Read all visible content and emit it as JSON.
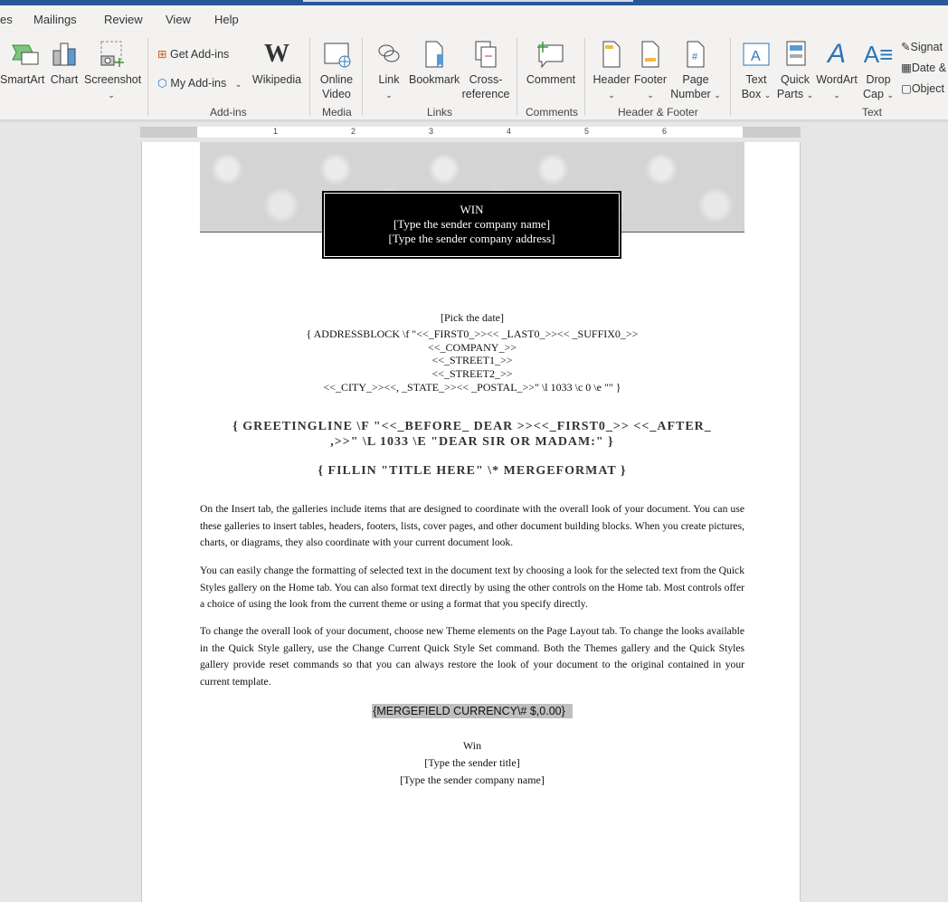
{
  "tabs": [
    "es",
    "Mailings",
    "Review",
    "View",
    "Help"
  ],
  "ribbon": {
    "illustrations": {
      "smartart": "SmartArt",
      "chart": "Chart",
      "screenshot": "Screenshot"
    },
    "addins": {
      "get": "Get Add-ins",
      "my": "My Add-ins",
      "wikipedia": "Wikipedia",
      "group": "Add-ins"
    },
    "media": {
      "online_video_1": "Online",
      "online_video_2": "Video",
      "group": "Media"
    },
    "links": {
      "link": "Link",
      "bookmark": "Bookmark",
      "cross1": "Cross-",
      "cross2": "reference",
      "group": "Links"
    },
    "comments": {
      "comment": "Comment",
      "group": "Comments"
    },
    "header_footer": {
      "header": "Header",
      "footer": "Footer",
      "page1": "Page",
      "page2": "Number",
      "group": "Header & Footer"
    },
    "text": {
      "textbox1": "Text",
      "textbox2": "Box",
      "quick1": "Quick",
      "quick2": "Parts",
      "wordart": "WordArt",
      "drop1": "Drop",
      "drop2": "Cap",
      "signature": "Signat",
      "date": "Date &",
      "object": "Object",
      "group": "Text"
    }
  },
  "ruler": [
    "1",
    "2",
    "3",
    "4",
    "5",
    "6"
  ],
  "doc": {
    "header_box": [
      "WIN",
      "[Type the sender company name]",
      "[Type the sender company address]"
    ],
    "date": "[Pick the date]",
    "address": [
      "{ ADDRESSBLOCK \\f \"<<_FIRST0_>><< _LAST0_>><< _SUFFIX0_>>",
      "<<_COMPANY_>>",
      "<<_STREET1_>>",
      "<<_STREET2_>>",
      "<<_CITY_>><<, _STATE_>><< _POSTAL_>>\" \\l 1033 \\c 0 \\e \"\" }"
    ],
    "greeting": [
      "{ GREETINGLINE \\F \"<<_BEFORE_ DEAR >><<_FIRST0_>> <<_AFTER_",
      ",>>\" \\L 1033 \\E \"DEAR SIR OR MADAM:\" }"
    ],
    "fillin": "{ FILLIN  \"TITLE HERE\"  \\* MERGEFORMAT }",
    "paragraphs": [
      "On the Insert tab, the galleries include items that are designed to coordinate with the overall look of your document. You can use these galleries to insert tables, headers, footers, lists, cover pages, and other document building blocks. When you create pictures, charts, or diagrams, they also coordinate with your current document look.",
      "You can easily change the formatting of selected text in the document text by choosing a look for the selected text from the Quick Styles gallery on the Home tab. You can also format text directly by using the other controls on the Home tab. Most controls offer a choice of using the look from the current theme or using a format that you specify directly.",
      "To change the overall look of your document, choose new Theme elements on the Page Layout tab. To change the looks available in the Quick Style gallery, use the Change Current Quick Style Set command. Both the Themes gallery and the Quick Styles gallery provide reset commands so that you can always restore the look of your document to the original contained in your current template."
    ],
    "mergefield": "{MERGEFIELD CURRENCY\\# $,0.00}",
    "signoff": [
      "Win",
      "[Type the sender title]",
      "[Type the sender company name]"
    ]
  },
  "colors": {
    "titlebar": "#2b579a",
    "ribbon": "#f3f2f1",
    "accent_blue": "#2e75b6"
  }
}
